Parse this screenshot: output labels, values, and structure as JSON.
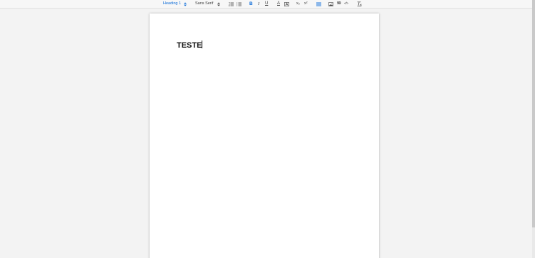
{
  "toolbar": {
    "heading_picker": {
      "label": "Heading 1",
      "arrow": "⬍"
    },
    "font_picker": {
      "label": "Sans Serif",
      "arrow": "⬍"
    },
    "icons": [
      "ordered-list-icon",
      "bullet-list-icon",
      "bold-icon",
      "italic-icon",
      "underline-icon",
      "font-color-icon",
      "background-color-icon",
      "subscript-icon",
      "superscript-icon",
      "align-icon",
      "image-icon",
      "blockquote-icon",
      "code-block-icon",
      "clear-formatting-icon"
    ],
    "bold_label": "B",
    "italic_label": "I",
    "underline_label": "U",
    "font_color_label": "A",
    "subscript_label": "x₂",
    "superscript_label": "x²",
    "blockquote_label": "99",
    "code_label": "</>",
    "active_color": "#0b6bd8"
  },
  "document": {
    "heading_text": "TESTE"
  }
}
